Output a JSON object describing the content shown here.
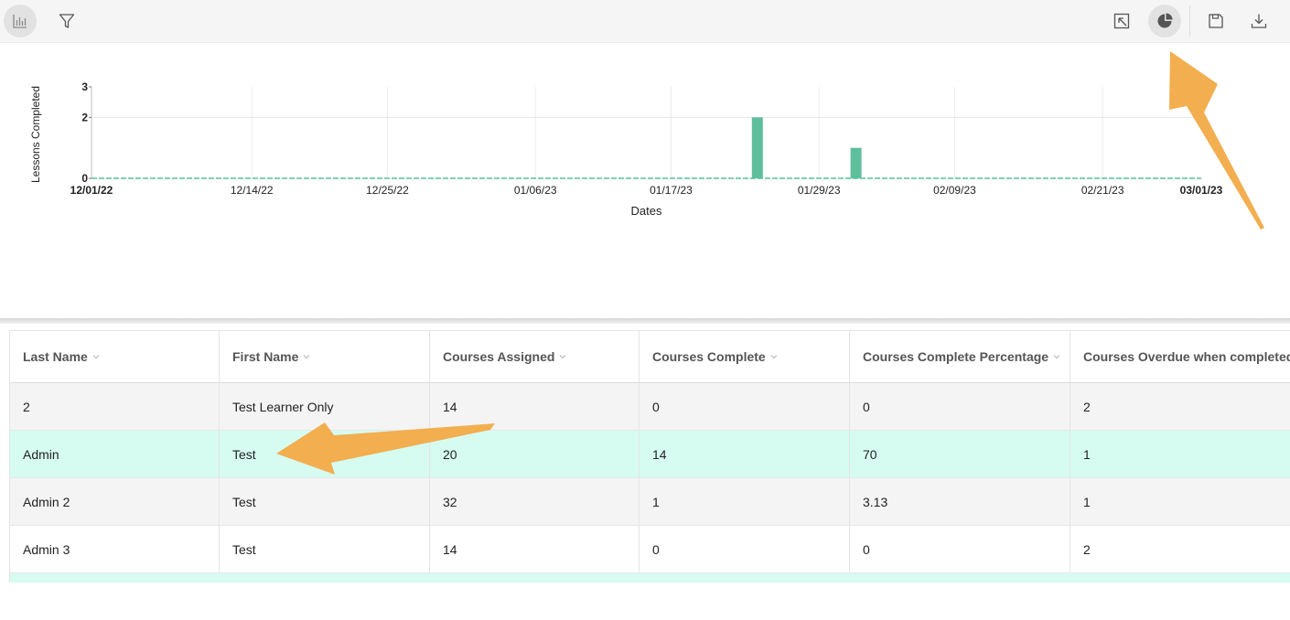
{
  "toolbar": {
    "left_icons": [
      "bar-chart-icon",
      "filter-icon"
    ],
    "right_icons": [
      "pop-out-icon",
      "pie-chart-icon",
      "save-icon",
      "download-icon"
    ]
  },
  "chart_data": {
    "type": "bar",
    "xlabel": "Dates",
    "ylabel": "Lessons Completed",
    "ylim": [
      0,
      3
    ],
    "yticks": [
      "0",
      "2",
      "3"
    ],
    "xticks": [
      "12/01/22",
      "12/14/22",
      "12/25/22",
      "01/06/23",
      "01/17/23",
      "01/29/23",
      "02/09/23",
      "02/21/23",
      "03/01/23"
    ],
    "series": [
      {
        "values": [
          {
            "x": "01/24/23",
            "y": 2
          },
          {
            "x": "02/01/23",
            "y": 1
          }
        ]
      }
    ],
    "bar_color": "#5dbf9c",
    "grid": true
  },
  "table": {
    "columns": [
      "Last Name",
      "First Name",
      "Courses Assigned",
      "Courses Complete",
      "Courses Complete Percentage",
      "Courses Overdue when completed"
    ],
    "rows": [
      [
        "2",
        "Test Learner Only",
        "14",
        "0",
        "0",
        "2"
      ],
      [
        "Admin",
        "Test",
        "20",
        "14",
        "70",
        "1"
      ],
      [
        "Admin 2",
        "Test",
        "32",
        "1",
        "3.13",
        "1"
      ],
      [
        "Admin 3",
        "Test",
        "14",
        "0",
        "0",
        "2"
      ]
    ],
    "selected_row": 1,
    "selected_color": "#d6fcf2"
  },
  "annotation_color": "#f2ae4f"
}
